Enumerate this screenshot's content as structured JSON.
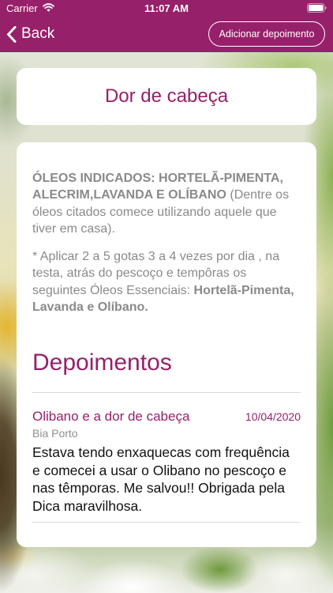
{
  "status_bar": {
    "carrier": "Carrier",
    "time": "11:07 AM",
    "wifi_icon": "wifi-icon",
    "battery_icon": "battery-icon"
  },
  "nav": {
    "back_icon": "chevron-left-icon",
    "back_label": "Back",
    "add_button_label": "Adicionar depoimento"
  },
  "header_card": {
    "title": "Dor de cabeça"
  },
  "content": {
    "paragraph1": {
      "bold": "ÓLEOS INDICADOS: HORTELÃ-PIMENTA, ALECRIM,LAVANDA E OLÍBANO",
      "text": " (Dentre os óleos citados comece utilizando aquele que tiver em casa)."
    },
    "paragraph2": {
      "text": "* Aplicar 2 a 5 gotas 3 a 4 vezes por dia , na testa, atrás do pescoço e tempôras os seguintes Óleos Essenciais: ",
      "bold": "Hortelã-Pimenta, Lavanda e Olíbano."
    }
  },
  "testimonials": {
    "heading": "Depoimentos",
    "items": [
      {
        "title": "Olibano e a dor de cabeça",
        "date": "10/04/2020",
        "author": "Bia Porto",
        "text": "Estava tendo enxaquecas com frequência e comecei a usar o Olibano no pescoço e nas têmporas. Me salvou!! Obrigada pela Dica maravilhosa."
      }
    ]
  },
  "colors": {
    "brand": "#97206a",
    "muted_text": "#8a8a8a"
  }
}
